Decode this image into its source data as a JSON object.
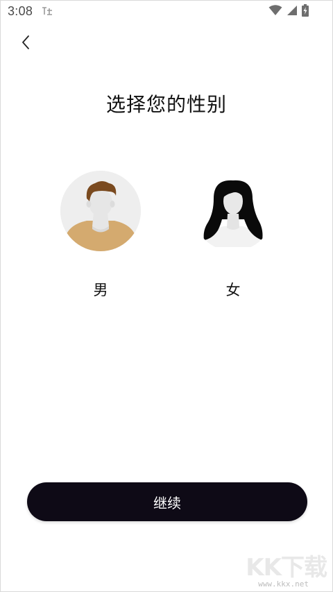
{
  "status_bar": {
    "time": "3:08",
    "notification_icon": "app-notification-icon",
    "wifi_icon": "wifi-icon",
    "signal_icon": "cell-signal-icon",
    "battery_icon": "battery-charging-icon"
  },
  "header": {
    "back_icon": "chevron-left-icon",
    "title": "选择您的性别"
  },
  "genders": [
    {
      "label": "男",
      "avatar_icon": "male-avatar-icon"
    },
    {
      "label": "女",
      "avatar_icon": "female-avatar-icon"
    }
  ],
  "footer": {
    "continue_label": "继续"
  },
  "watermark": {
    "big_text": "KK下载",
    "small_text": "www.kkx.net"
  },
  "colors": {
    "button_bg": "#0e0a16",
    "male_shirt": "#d4aa6f",
    "male_hair": "#7a4a1f",
    "avatar_bg": "#eeeeee"
  }
}
